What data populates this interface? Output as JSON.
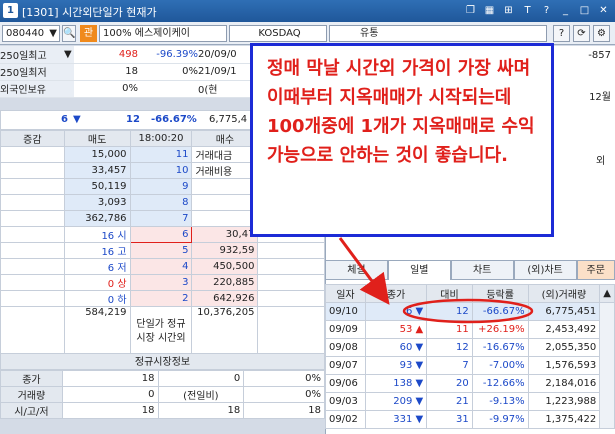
{
  "window": {
    "number": "1",
    "title": "[1301] 시간외단일가 현재가",
    "icons": [
      "restore-icon",
      "tile-icon",
      "layout-icon",
      "font-icon",
      "help-icon",
      "minimize-icon",
      "maximize-icon",
      "close-icon"
    ],
    "accent": "#1f579a"
  },
  "codebar": {
    "code": "080440",
    "badge": "관",
    "margin": "100%",
    "name": "에스제이케이",
    "market": "KOSDAQ",
    "status": "유통",
    "btn_help": "?",
    "btn_refresh": "⟳",
    "btn_settings": "⚙"
  },
  "info": {
    "rows": [
      {
        "label": "250일최고",
        "v1": "498",
        "v2": "-96.39%",
        "v3": "20/09/0"
      },
      {
        "label": "250일최저",
        "v1": "18",
        "v2": "0%",
        "v3": "21/09/1"
      },
      {
        "label": "외국인보유",
        "v1": "0%",
        "v2": "",
        "v3": "0(현"
      }
    ],
    "right_value": "-857",
    "right_month": "12월"
  },
  "summary": {
    "price": "6",
    "change": "12",
    "rate": "-66.67%",
    "volume": "6,775,4"
  },
  "orderbook": {
    "headers": [
      "증감",
      "매도",
      "18:00:20",
      "매수"
    ],
    "sells": [
      {
        "qty": "15,000",
        "price": "11",
        "label": "거래대금"
      },
      {
        "qty": "33,457",
        "price": "10",
        "label": "거래비용"
      },
      {
        "qty": "50,119",
        "price": "9",
        "label": ""
      },
      {
        "qty": "3,093",
        "price": "8",
        "label": ""
      },
      {
        "qty": "362,786",
        "price": "7",
        "label": ""
      }
    ],
    "buys": [
      {
        "stat": "16 시",
        "price": "6",
        "qty": "30,47"
      },
      {
        "stat": "16 고",
        "price": "5",
        "qty": "932,59"
      },
      {
        "stat": "6 저",
        "price": "4",
        "qty": "450,500"
      },
      {
        "stat": "0 상",
        "price": "3",
        "qty": "220,885"
      },
      {
        "stat": "0 하",
        "price": "2",
        "qty": "642,926"
      }
    ],
    "total_sell": "584,219",
    "total_label": "단일가 정규시장 시간외",
    "total_buy": "10,376,205"
  },
  "regular": {
    "title": "정규시장정보",
    "rows": [
      {
        "label": "종가",
        "v1": "18",
        "v2": "0",
        "v3": "0%"
      },
      {
        "label": "거래량",
        "v1": "0",
        "v2": "(전일비)",
        "v3": "0%"
      },
      {
        "label": "시/고/저",
        "v1": "18",
        "v2": "18",
        "v3": "18"
      }
    ]
  },
  "right_panel": {
    "tabs": [
      "체결",
      "일별",
      "차트",
      "(외)차트",
      "주문"
    ],
    "headers": [
      "일자",
      "종가",
      "대비",
      "등락률",
      "(외)거래량"
    ],
    "rows": [
      {
        "date": "09/10",
        "close": "6",
        "dir": "▼",
        "diff": "12",
        "rate": "-66.67%",
        "vol": "6,775,451"
      },
      {
        "date": "09/09",
        "close": "53",
        "dir": "▲",
        "diff": "11",
        "rate": "+26.19%",
        "vol": "2,453,492"
      },
      {
        "date": "09/08",
        "close": "60",
        "dir": "▼",
        "diff": "12",
        "rate": "-16.67%",
        "vol": "2,055,350"
      },
      {
        "date": "09/07",
        "close": "93",
        "dir": "▼",
        "diff": "7",
        "rate": "-7.00%",
        "vol": "1,576,593"
      },
      {
        "date": "09/06",
        "close": "138",
        "dir": "▼",
        "diff": "20",
        "rate": "-12.66%",
        "vol": "2,184,016"
      },
      {
        "date": "09/03",
        "close": "209",
        "dir": "▼",
        "diff": "21",
        "rate": "-9.13%",
        "vol": "1,223,988"
      },
      {
        "date": "09/02",
        "close": "331",
        "dir": "▼",
        "diff": "31",
        "rate": "-9.97%",
        "vol": "1,375,422"
      }
    ],
    "partial_text": "외"
  },
  "annotation": {
    "text": "정매 막날 시간외 가격이 가장 싸며 이때부터 지옥매매가 시작되는데 100개중에 1개가 지옥매매로 수익가능으로 안하는 것이 좋습니다.",
    "color": "#e0201b",
    "border_color": "#1c2bd6"
  }
}
